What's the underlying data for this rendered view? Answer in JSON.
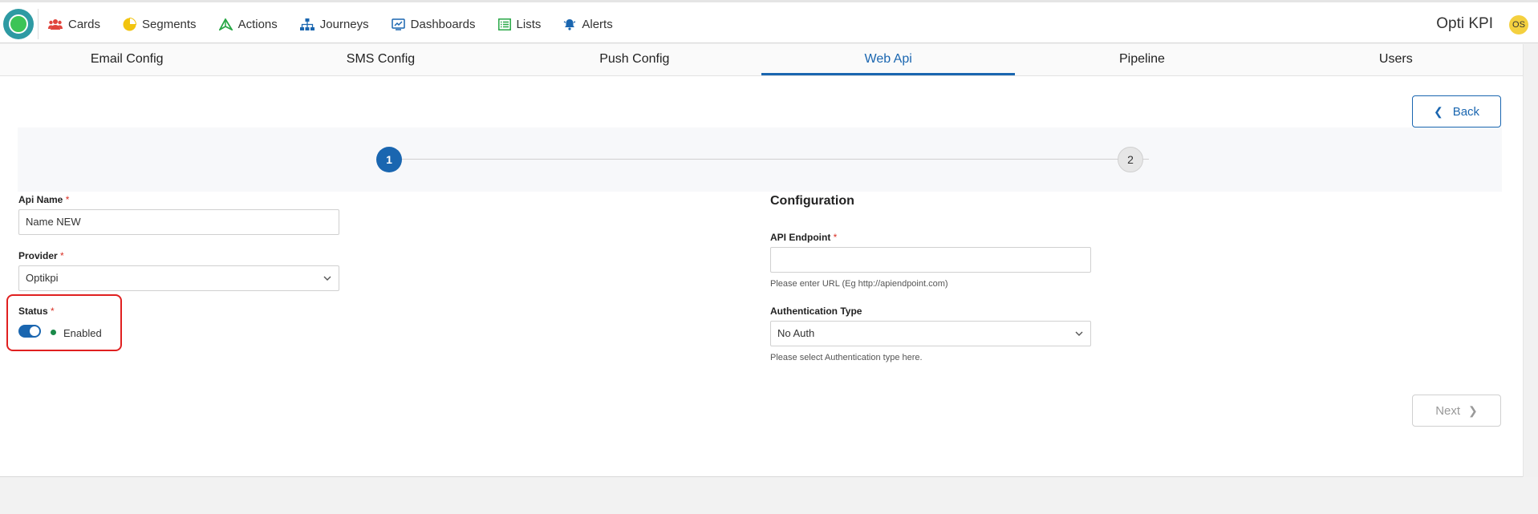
{
  "nav": {
    "items": [
      {
        "label": "Cards",
        "icon": "users-icon",
        "color": "#e0443c"
      },
      {
        "label": "Segments",
        "icon": "pie-chart-icon",
        "color": "#f2c40f"
      },
      {
        "label": "Actions",
        "icon": "send-icon",
        "color": "#27a745"
      },
      {
        "label": "Journeys",
        "icon": "sitemap-icon",
        "color": "#1a66b0"
      },
      {
        "label": "Dashboards",
        "icon": "dashboard-icon",
        "color": "#1a66b0"
      },
      {
        "label": "Lists",
        "icon": "list-icon",
        "color": "#27a745"
      },
      {
        "label": "Alerts",
        "icon": "bell-icon",
        "color": "#1a66b0"
      }
    ],
    "brand": "Opti KPI",
    "avatar": "OS"
  },
  "tabs": [
    "Email Config",
    "SMS Config",
    "Push Config",
    "Web Api",
    "Pipeline",
    "Users"
  ],
  "active_tab": "Web Api",
  "back_label": "Back",
  "next_label": "Next",
  "steps": [
    "1",
    "2"
  ],
  "form": {
    "api_name_label": "Api Name",
    "api_name_value": "Name NEW",
    "provider_label": "Provider",
    "provider_value": "Optikpi",
    "status_label": "Status",
    "status_value": "Enabled",
    "required_mark": "*"
  },
  "config": {
    "title": "Configuration",
    "endpoint_label": "API Endpoint",
    "endpoint_value": "",
    "endpoint_hint": "Please enter URL (Eg http://apiendpoint.com)",
    "auth_label": "Authentication Type",
    "auth_value": "No Auth",
    "auth_hint": "Please select Authentication type here."
  },
  "colors": {
    "accent": "#1a66b0",
    "highlight": "#e02020",
    "status_dot": "#1a8a4a"
  }
}
